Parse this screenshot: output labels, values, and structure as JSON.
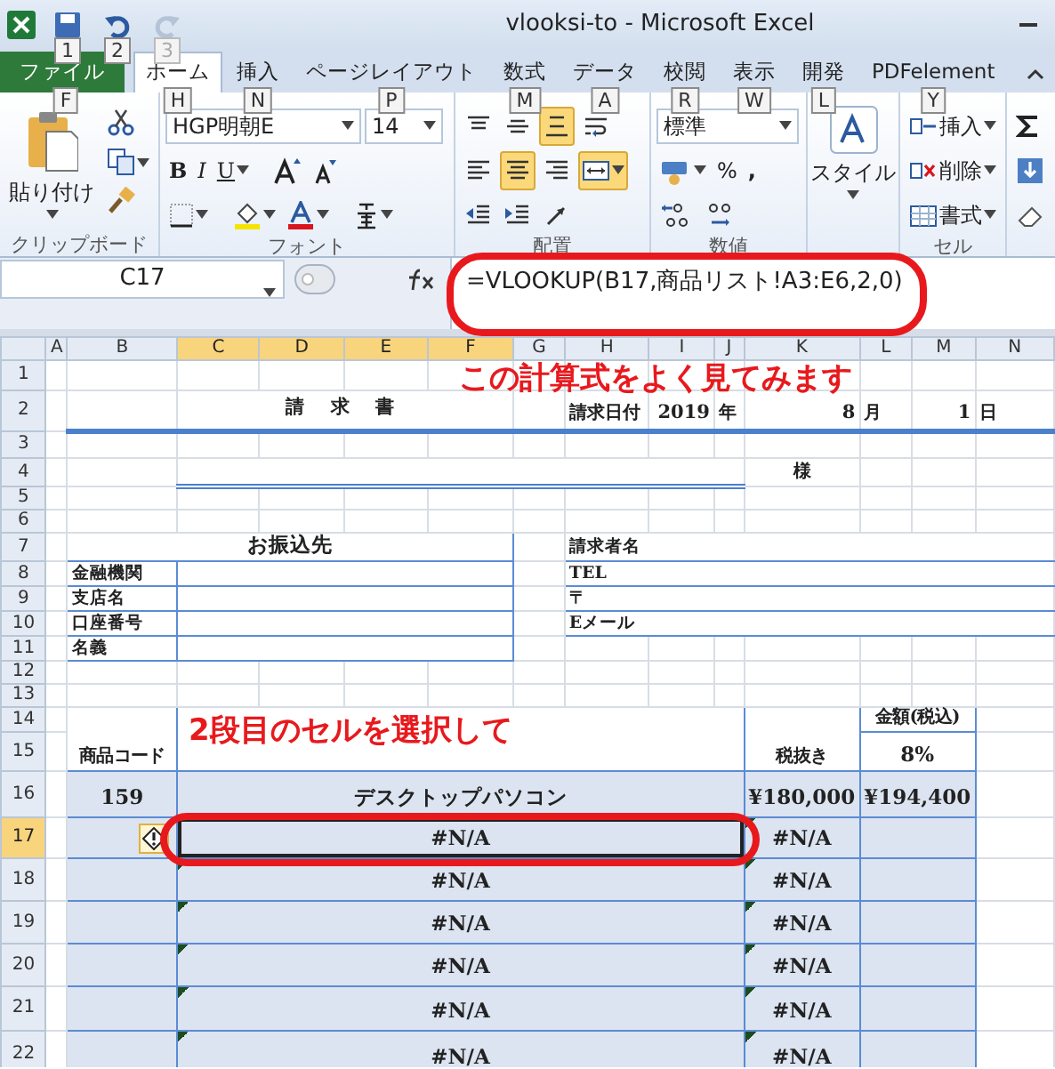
{
  "window": {
    "title": "vlooksi-to  -  Microsoft Excel",
    "quick_access": [
      {
        "kind": "save",
        "keytip": "1",
        "disabled": false
      },
      {
        "kind": "undo",
        "keytip": "2",
        "disabled": false
      },
      {
        "kind": "redo",
        "keytip": "3",
        "disabled": true
      }
    ]
  },
  "tabs": [
    {
      "label": "ファイル",
      "keytip": "F",
      "kind": "file",
      "selected": false
    },
    {
      "label": "ホーム",
      "keytip": "H",
      "kind": "tab",
      "selected": true
    },
    {
      "label": "挿入",
      "keytip": "N",
      "kind": "tab",
      "selected": false
    },
    {
      "label": "ページレイアウト",
      "keytip": "P",
      "kind": "tab",
      "selected": false
    },
    {
      "label": "数式",
      "keytip": "M",
      "kind": "tab",
      "selected": false
    },
    {
      "label": "データ",
      "keytip": "A",
      "kind": "tab",
      "selected": false
    },
    {
      "label": "校閲",
      "keytip": "R",
      "kind": "tab",
      "selected": false
    },
    {
      "label": "表示",
      "keytip": "W",
      "kind": "tab",
      "selected": false
    },
    {
      "label": "開発",
      "keytip": "L",
      "kind": "tab",
      "selected": false
    },
    {
      "label": "PDFelement",
      "keytip": "Y",
      "kind": "tab",
      "selected": false
    }
  ],
  "ribbon": {
    "clipboard": {
      "label": "クリップボード",
      "paste": "貼り付け"
    },
    "font": {
      "label": "フォント",
      "name": "HGP明朝E",
      "size": "14",
      "bold": "B",
      "italic": "I",
      "underline": "U"
    },
    "alignment": {
      "label": "配置",
      "tools": [
        {
          "kind": "align-top",
          "pressed": false
        },
        {
          "kind": "align-middle",
          "pressed": false
        },
        {
          "kind": "align-bottom",
          "pressed": true
        },
        {
          "kind": "wrap",
          "pressed": false
        },
        {
          "kind": "left",
          "pressed": false
        },
        {
          "kind": "center",
          "pressed": true
        },
        {
          "kind": "right",
          "pressed": false
        },
        {
          "kind": "merge",
          "pressed": true
        },
        {
          "kind": "outdent",
          "pressed": false
        },
        {
          "kind": "indent",
          "pressed": false
        },
        {
          "kind": "orientation",
          "pressed": false
        }
      ]
    },
    "number": {
      "label": "数値",
      "format": "標準",
      "percent": "%",
      "comma": ","
    },
    "styles": {
      "label": "スタイル"
    },
    "cells": {
      "label": "セル",
      "insert": "挿入",
      "delete": "削除",
      "format": "書式"
    }
  },
  "formula_bar": {
    "name_box": "C17",
    "formula": "=VLOOKUP(B17,商品リスト!A3:E6,2,0)"
  },
  "sheet": {
    "columns": [
      {
        "label": "A",
        "selected": false
      },
      {
        "label": "B",
        "selected": false
      },
      {
        "label": "C",
        "selected": true
      },
      {
        "label": "D",
        "selected": true
      },
      {
        "label": "E",
        "selected": true
      },
      {
        "label": "F",
        "selected": true
      },
      {
        "label": "G",
        "selected": false
      },
      {
        "label": "H",
        "selected": false
      },
      {
        "label": "I",
        "selected": false
      },
      {
        "label": "J",
        "selected": false
      },
      {
        "label": "K",
        "selected": false
      },
      {
        "label": "L",
        "selected": false
      },
      {
        "label": "M",
        "selected": false
      },
      {
        "label": "N",
        "selected": false
      }
    ],
    "rows": [
      {
        "label": "1",
        "selected": false
      },
      {
        "label": "2",
        "selected": false,
        "cells": [
          {
            "text": "請 求 書",
            "kind": "title"
          },
          {
            "text": "請求日付",
            "kind": "unit"
          },
          {
            "text": "2019",
            "kind": "num"
          },
          {
            "text": "年",
            "kind": "unit"
          },
          {
            "text": "8",
            "kind": "num"
          },
          {
            "text": "月",
            "kind": "unit"
          },
          {
            "text": "1",
            "kind": "num"
          },
          {
            "text": "日",
            "kind": "unit"
          }
        ]
      },
      {
        "label": "3",
        "selected": false
      },
      {
        "label": "4",
        "selected": false,
        "cells": [
          {
            "text": "様",
            "kind": "heading"
          }
        ]
      },
      {
        "label": "5",
        "selected": false
      },
      {
        "label": "6",
        "selected": false
      },
      {
        "label": "7",
        "selected": false,
        "cells": [
          {
            "text": "お振込先",
            "kind": "value"
          },
          {
            "text": "請求者名",
            "kind": "label"
          }
        ]
      },
      {
        "label": "8",
        "selected": false,
        "cells": [
          {
            "text": "金融機関",
            "kind": "label"
          },
          {
            "text": "TEL",
            "kind": "label"
          }
        ]
      },
      {
        "label": "9",
        "selected": false,
        "cells": [
          {
            "text": "支店名",
            "kind": "label"
          },
          {
            "text": "〒",
            "kind": "label"
          }
        ]
      },
      {
        "label": "10",
        "selected": false,
        "cells": [
          {
            "text": "口座番号",
            "kind": "label"
          },
          {
            "text": "Eメール",
            "kind": "label"
          }
        ]
      },
      {
        "label": "11",
        "selected": false,
        "cells": [
          {
            "text": "名義",
            "kind": "label"
          }
        ]
      },
      {
        "label": "12",
        "selected": false
      },
      {
        "label": "13",
        "selected": false
      },
      {
        "label": "14",
        "selected": false,
        "cells": [
          {
            "text": "金額(税込)",
            "kind": "heading"
          }
        ]
      },
      {
        "label": "15",
        "selected": false,
        "cells": [
          {
            "text": "商品コード",
            "kind": "heading"
          },
          {
            "text": "税抜き",
            "kind": "heading"
          },
          {
            "text": "8%",
            "kind": "value"
          }
        ]
      },
      {
        "label": "16",
        "selected": false,
        "cells": [
          {
            "text": "159",
            "kind": "value",
            "fill": true
          },
          {
            "text": "デスクトップパソコン",
            "kind": "value",
            "fill": true
          },
          {
            "text": "¥180,000",
            "kind": "value",
            "fill": true
          },
          {
            "text": "¥194,400",
            "kind": "value",
            "fill": true
          }
        ]
      },
      {
        "label": "17",
        "selected": true,
        "cells": [
          {
            "fill": true,
            "warning": true
          },
          {
            "text": "#N/A",
            "kind": "value",
            "fill": true,
            "flagged": false,
            "selected": true
          },
          {
            "text": "#N/A",
            "kind": "value",
            "fill": true,
            "flagged": true
          },
          {
            "fill": true
          }
        ]
      },
      {
        "label": "18",
        "selected": false,
        "cells": [
          {
            "fill": true
          },
          {
            "text": "#N/A",
            "kind": "value",
            "fill": true,
            "flagged": true,
            "selected": false
          },
          {
            "text": "#N/A",
            "kind": "value",
            "fill": true,
            "flagged": true
          },
          {
            "fill": true
          }
        ]
      },
      {
        "label": "19",
        "selected": false,
        "cells": [
          {
            "fill": true
          },
          {
            "text": "#N/A",
            "kind": "value",
            "fill": true,
            "flagged": true,
            "selected": false
          },
          {
            "text": "#N/A",
            "kind": "value",
            "fill": true,
            "flagged": true
          },
          {
            "fill": true
          }
        ]
      },
      {
        "label": "20",
        "selected": false,
        "cells": [
          {
            "fill": true
          },
          {
            "text": "#N/A",
            "kind": "value",
            "fill": true,
            "flagged": true,
            "selected": false
          },
          {
            "text": "#N/A",
            "kind": "value",
            "fill": true,
            "flagged": true
          },
          {
            "fill": true
          }
        ]
      },
      {
        "label": "21",
        "selected": false,
        "cells": [
          {
            "fill": true
          },
          {
            "text": "#N/A",
            "kind": "value",
            "fill": true,
            "flagged": true,
            "selected": false
          },
          {
            "text": "#N/A",
            "kind": "value",
            "fill": true,
            "flagged": true
          },
          {
            "fill": true
          }
        ]
      },
      {
        "label": "22",
        "selected": false,
        "cells": [
          {
            "fill": true
          },
          {
            "text": "#N/A",
            "kind": "value",
            "fill": true,
            "flagged": true,
            "selected": false
          },
          {
            "text": "#N/A",
            "kind": "value",
            "fill": true,
            "flagged": true
          },
          {
            "fill": true
          }
        ]
      }
    ]
  },
  "annotations": [
    {
      "kind": "formula-note",
      "text": "この計算式をよく見てみます"
    },
    {
      "kind": "cell-note",
      "text": "2段目のセルを選択して"
    }
  ]
}
